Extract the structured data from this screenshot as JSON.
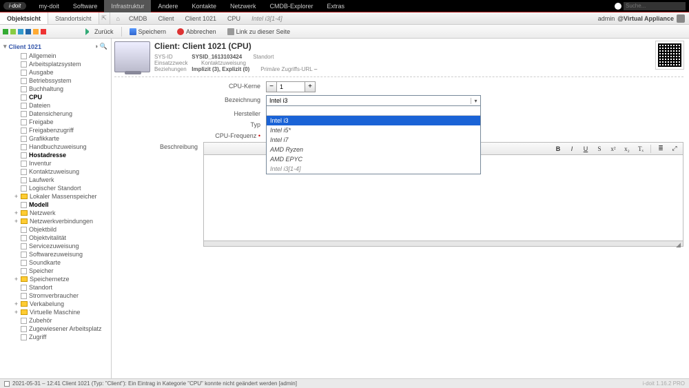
{
  "top_nav": {
    "logo": "i-doit",
    "items": [
      "my-doit",
      "Software",
      "Infrastruktur",
      "Andere",
      "Kontakte",
      "Netzwerk",
      "CMDB-Explorer",
      "Extras"
    ],
    "active_index": 2,
    "search_placeholder": "Suche..."
  },
  "second_bar": {
    "tabs": [
      "Objektsicht",
      "Standortsicht"
    ],
    "active_tab": 0,
    "breadcrumb": [
      "CMDB",
      "Client",
      "Client 1021",
      "CPU"
    ],
    "breadcrumb_current": "Intel i3[1-4]",
    "user_label": "admin",
    "tenant_label": "@Virtual Appliance"
  },
  "toolbar": {
    "back": "Zurück",
    "save": "Speichern",
    "cancel": "Abbrechen",
    "link": "Link zu dieser Seite"
  },
  "tree": {
    "root": "Client 1021",
    "items": [
      {
        "label": "Allgemein",
        "type": "doc"
      },
      {
        "label": "Arbeitsplatzsystem",
        "type": "doc"
      },
      {
        "label": "Ausgabe",
        "type": "doc"
      },
      {
        "label": "Betriebssystem",
        "type": "doc"
      },
      {
        "label": "Buchhaltung",
        "type": "doc"
      },
      {
        "label": "CPU",
        "type": "doc",
        "bold": true
      },
      {
        "label": "Dateien",
        "type": "doc"
      },
      {
        "label": "Datensicherung",
        "type": "doc"
      },
      {
        "label": "Freigabe",
        "type": "doc"
      },
      {
        "label": "Freigabenzugriff",
        "type": "doc"
      },
      {
        "label": "Grafikkarte",
        "type": "doc"
      },
      {
        "label": "Handbuchzuweisung",
        "type": "doc"
      },
      {
        "label": "Hostadresse",
        "type": "doc",
        "bold": true
      },
      {
        "label": "Inventur",
        "type": "doc"
      },
      {
        "label": "Kontaktzuweisung",
        "type": "doc"
      },
      {
        "label": "Laufwerk",
        "type": "doc"
      },
      {
        "label": "Logischer Standort",
        "type": "doc"
      },
      {
        "label": "Lokaler Massenspeicher",
        "type": "folder",
        "expander": "+"
      },
      {
        "label": "Modell",
        "type": "doc",
        "bold": true
      },
      {
        "label": "Netzwerk",
        "type": "folder",
        "expander": "+"
      },
      {
        "label": "Netzwerkverbindungen",
        "type": "folder",
        "expander": "+"
      },
      {
        "label": "Objektbild",
        "type": "doc"
      },
      {
        "label": "Objektvitalität",
        "type": "doc"
      },
      {
        "label": "Servicezuweisung",
        "type": "doc"
      },
      {
        "label": "Softwarezuweisung",
        "type": "doc"
      },
      {
        "label": "Soundkarte",
        "type": "doc"
      },
      {
        "label": "Speicher",
        "type": "doc"
      },
      {
        "label": "Speichernetze",
        "type": "folder",
        "expander": "+"
      },
      {
        "label": "Standort",
        "type": "doc"
      },
      {
        "label": "Stromverbraucher",
        "type": "doc"
      },
      {
        "label": "Verkabelung",
        "type": "folder",
        "expander": "+"
      },
      {
        "label": "Virtuelle Maschine",
        "type": "folder",
        "expander": "+"
      },
      {
        "label": "Zubehör",
        "type": "doc"
      },
      {
        "label": "Zugewiesener Arbeitsplatz",
        "type": "doc"
      },
      {
        "label": "Zugriff",
        "type": "doc"
      }
    ]
  },
  "header": {
    "title": "Client: Client 1021 (CPU)",
    "meta": {
      "sysid_label": "SYS-ID",
      "sysid_value": "SYSID_1613103424",
      "standort_label": "Standort",
      "einsatzzweck_label": "Einsatzzweck",
      "kontaktzuweisung_label": "Kontaktzuweisung",
      "beziehungen_label": "Beziehungen",
      "beziehungen_value": "Implizit (3), Explizit (0)",
      "zugriffs_label": "Primäre Zugriffs-URL",
      "zugriffs_value": "–"
    }
  },
  "form": {
    "cpu_kerne": {
      "label": "CPU-Kerne",
      "value": "1"
    },
    "bezeichnung": {
      "label": "Bezeichnung",
      "value": "Intel i3"
    },
    "hersteller": {
      "label": "Hersteller"
    },
    "typ": {
      "label": "Typ"
    },
    "cpu_frequenz": {
      "label": "CPU-Frequenz"
    },
    "beschreibung": {
      "label": "Beschreibung"
    },
    "dropdown_options": [
      "Intel i3",
      "Intel i5*",
      "Intel i7",
      "AMD Ryzen",
      "AMD EPYC",
      "Intel i3[1-4]"
    ]
  },
  "rte_buttons": [
    "B",
    "I",
    "U",
    "S",
    "x²",
    "x₂",
    "Tₓ",
    "≣",
    "⤢"
  ],
  "status": {
    "text": "2021-05-31 – 12:41 Client 1021 (Typ: \"Client\"): Ein Eintrag in Kategorie \"CPU\" konnte nicht geändert werden [admin]",
    "right": "i-doit 1.16.2 PRO"
  }
}
